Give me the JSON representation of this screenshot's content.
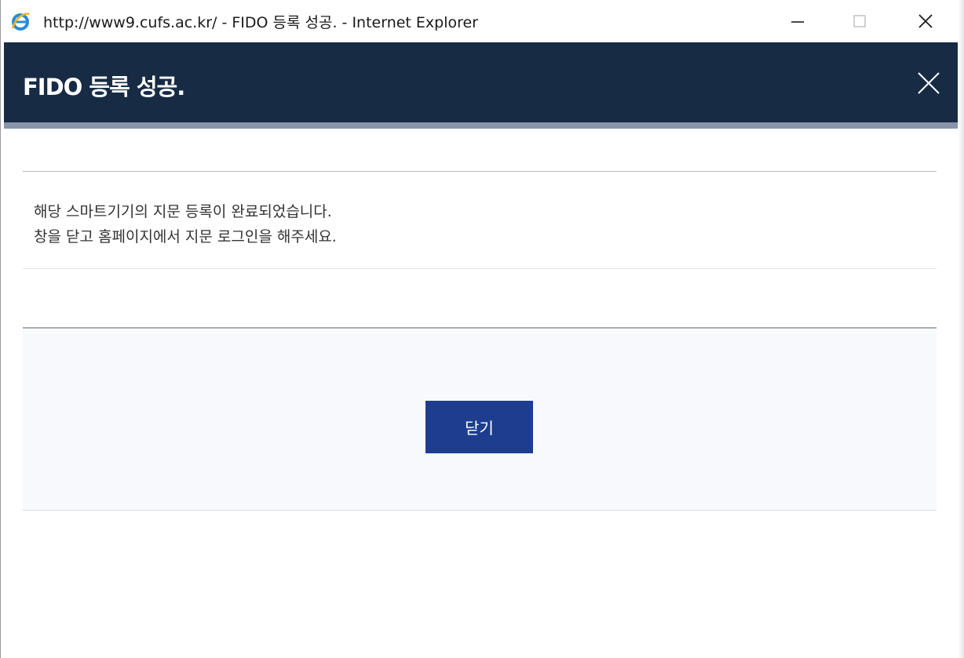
{
  "window": {
    "title": "http://www9.cufs.ac.kr/ - FIDO 등록 성공. - Internet Explorer",
    "icon": "internet-explorer-icon"
  },
  "modal": {
    "title": "FIDO 등록 성공.",
    "message_line1": "해당 스마트기기의 지문 등록이 완료되었습니다.",
    "message_line2": "창을 닫고 홈페이지에서 지문 로그인을 해주세요.",
    "close_button_label": "닫기",
    "colors": {
      "header_bg": "#172b45",
      "button_bg": "#1e3d8f"
    }
  }
}
